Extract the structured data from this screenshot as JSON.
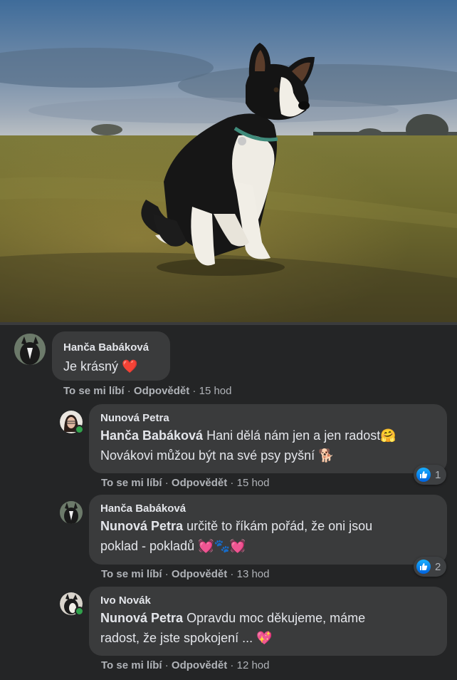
{
  "photo": {
    "alt": "Border collie puppy sitting in a meadow"
  },
  "comments": [
    {
      "author": "Hanča Babáková",
      "text": "Je krásný",
      "emoji": "❤️",
      "like_label": "To se mi líbí",
      "reply_label": "Odpovědět",
      "time": "15 hod"
    }
  ],
  "replies": [
    {
      "author": "Nunová Petra",
      "mention": "Hanča Babáková",
      "text_line1": "Hani dělá nám jen a jen radost🤗",
      "text_line2": "Novákovi můžou být na své psy pyšní 🐕",
      "like_label": "To se mi líbí",
      "reply_label": "Odpovědět",
      "time": "15 hod",
      "reactions": "1"
    },
    {
      "author": "Hanča Babáková",
      "mention": "Nunová Petra",
      "text_line1": "určitě to říkám pořád, že oni jsou",
      "text_line2": "poklad - pokladů 💓🐾💓",
      "like_label": "To se mi líbí",
      "reply_label": "Odpovědět",
      "time": "13 hod",
      "reactions": "2"
    },
    {
      "author": "Ivo Novák",
      "mention": "Nunová Petra",
      "text_line1": "Opravdu moc děkujeme, máme",
      "text_line2": "radost, že jste spokojení ... 💖",
      "like_label": "To se mi líbí",
      "reply_label": "Odpovědět",
      "time": "12 hod"
    }
  ],
  "colors": {
    "background": "#242526",
    "bubble": "#3a3b3c",
    "like_blue": "#1877f2",
    "online_green": "#31a24c"
  },
  "separator": " · "
}
